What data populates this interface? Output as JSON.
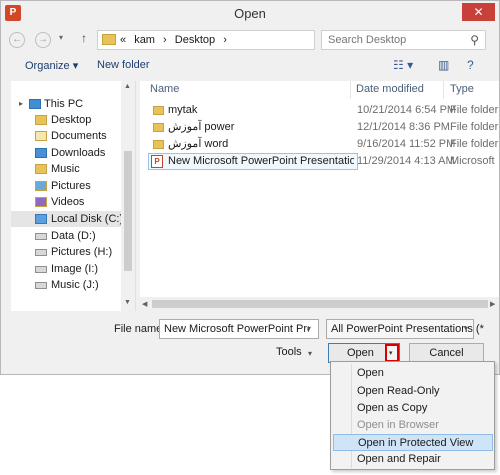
{
  "window": {
    "title": "Open",
    "app_icon": "P",
    "close_glyph": "✕"
  },
  "nav": {
    "back_glyph": "←",
    "forward_glyph": "→",
    "recent_glyph": "▾",
    "up_glyph": "↑",
    "breadcrumb": [
      "«",
      "kam",
      "›",
      "Desktop",
      "›"
    ],
    "address_dropdown_glyph": "▾",
    "refresh_glyph": "↻",
    "search_placeholder": "Search Desktop",
    "search_glyph": "⚲"
  },
  "toolbar": {
    "organize_label": "Organize ▾",
    "new_folder_label": "New folder",
    "view_glyph": "☷ ▾",
    "preview_glyph": "▥",
    "help_glyph": "?"
  },
  "sidebar": {
    "items": [
      {
        "label": "This PC",
        "icon": "pc-icon"
      },
      {
        "label": "Desktop",
        "icon": "folder-icon"
      },
      {
        "label": "Documents",
        "icon": "documents-icon"
      },
      {
        "label": "Downloads",
        "icon": "downloads-icon"
      },
      {
        "label": "Music",
        "icon": "music-icon"
      },
      {
        "label": "Pictures",
        "icon": "pictures-icon"
      },
      {
        "label": "Videos",
        "icon": "videos-icon"
      },
      {
        "label": "Local Disk (C:)",
        "icon": "system-disk-icon"
      },
      {
        "label": "Data (D:)",
        "icon": "disk-icon"
      },
      {
        "label": "Pictures (H:)",
        "icon": "disk-icon"
      },
      {
        "label": "Image (I:)",
        "icon": "disk-icon"
      },
      {
        "label": "Music (J:)",
        "icon": "disk-icon"
      }
    ],
    "expand_glyph": "▸",
    "scroll_up_glyph": "▲",
    "scroll_down_glyph": "▼"
  },
  "filelist": {
    "columns": [
      "Name",
      "Date modified",
      "Type"
    ],
    "rows": [
      {
        "name": "mytak",
        "date": "10/21/2014 6:54 PM",
        "type": "File folder",
        "icon": "folder-icon"
      },
      {
        "name": "آموزش power",
        "date": "12/1/2014 8:36 PM",
        "type": "File folder",
        "icon": "folder-icon"
      },
      {
        "name": "آموزش word",
        "date": "9/16/2014 11:52 PM",
        "type": "File folder",
        "icon": "folder-icon"
      },
      {
        "name": "New Microsoft PowerPoint Presentation....",
        "date": "11/29/2014 4:13 AM",
        "type": "Microsoft",
        "icon": "powerpoint-file-icon"
      }
    ],
    "scroll_left_glyph": "◀",
    "scroll_right_glyph": "▶"
  },
  "bottom": {
    "file_name_label": "File name:",
    "file_name_value": "New Microsoft PowerPoint Presen",
    "file_type_value": "All PowerPoint Presentations (*",
    "dropdown_glyph": "▾",
    "tools_label": "Tools",
    "open_label": "Open",
    "cancel_label": "Cancel"
  },
  "open_menu": {
    "items": [
      {
        "label": "Open",
        "state": "normal"
      },
      {
        "label": "Open Read-Only",
        "state": "normal"
      },
      {
        "label": "Open as Copy",
        "state": "normal"
      },
      {
        "label": "Open in Browser",
        "state": "disabled"
      },
      {
        "label": "Open in Protected View",
        "state": "highlight"
      },
      {
        "label": "Open and Repair",
        "state": "normal"
      }
    ]
  },
  "colors": {
    "accent_border": "#3c7fb1",
    "highlight_box": "#d80000",
    "menu_hover": "#cfe4f7"
  }
}
